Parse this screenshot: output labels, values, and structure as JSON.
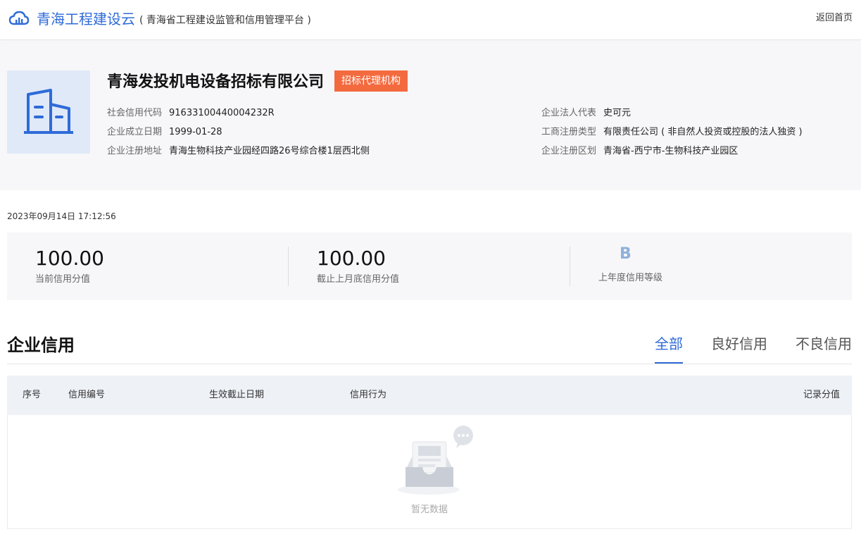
{
  "header": {
    "site_title": "青海工程建设云",
    "site_subtitle": "( 青海省工程建设监管和信用管理平台 )",
    "back_link": "返回首页"
  },
  "company": {
    "name": "青海发投机电设备招标有限公司",
    "badge": "招标代理机构",
    "left_info": [
      {
        "label": "社会信用代码",
        "value": "91633100440004232R"
      },
      {
        "label": "企业成立日期",
        "value": "1999-01-28"
      },
      {
        "label": "企业注册地址",
        "value": "青海生物科技产业园经四路26号综合楼1层西北侧"
      }
    ],
    "right_info": [
      {
        "label": "企业法人代表",
        "value": "史可元"
      },
      {
        "label": "工商注册类型",
        "value": "有限责任公司 ( 非自然人投资或控股的法人独资 )"
      },
      {
        "label": "企业注册区划",
        "value": "青海省-西宁市-生物科技产业园区"
      }
    ]
  },
  "date": "2023年09月14日 17:12:56",
  "scores": {
    "current_value": "100.00",
    "current_label": "当前信用分值",
    "last_month_value": "100.00",
    "last_month_label": "截止上月底信用分值",
    "grade_value": "B",
    "grade_label": "上年度信用等级"
  },
  "credit_section": {
    "title": "企业信用",
    "tabs": [
      "全部",
      "良好信用",
      "不良信用"
    ],
    "active_tab": 0,
    "columns": [
      "序号",
      "信用编号",
      "生效截止日期",
      "信用行为",
      "记录分值"
    ],
    "empty_text": "暂无数据"
  },
  "colors": {
    "brand": "#2f6bd8",
    "badge": "#f46a3f",
    "panel_bg": "#f7f7f9",
    "table_head_bg": "#eef1f6"
  },
  "icons": {
    "logo": "cloud-icon",
    "company": "building-icon",
    "empty": "empty-inbox-icon"
  }
}
